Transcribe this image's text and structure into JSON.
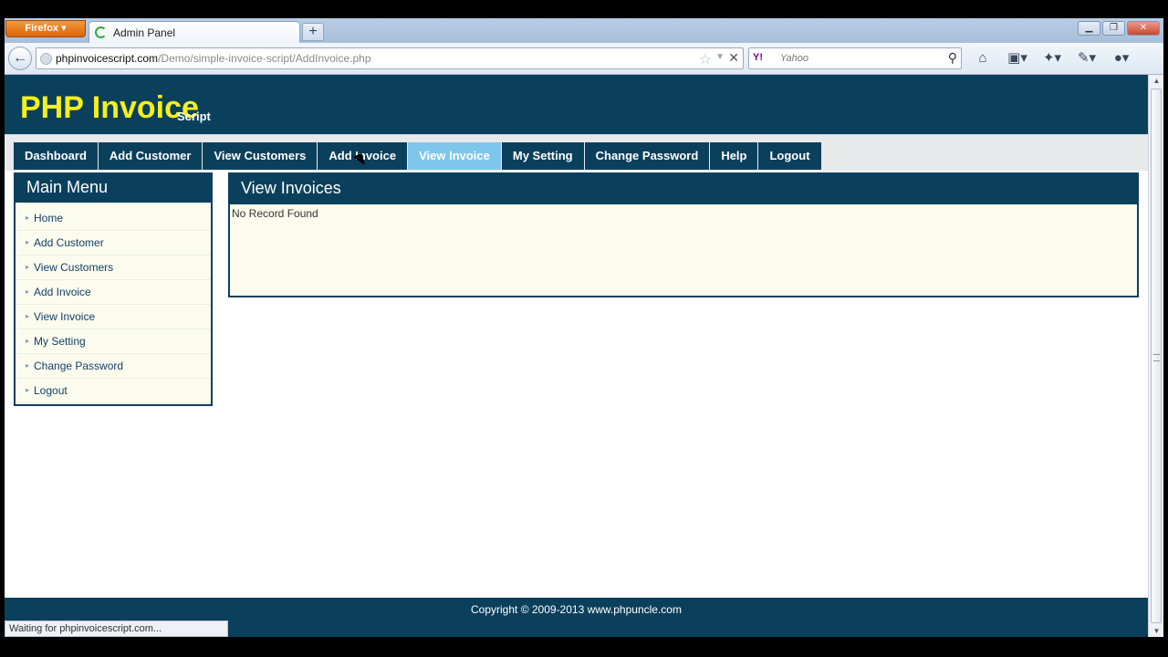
{
  "browser": {
    "firefox_label": "Firefox",
    "tab_title": "Admin Panel",
    "newtab_label": "+",
    "back_label": "←",
    "url_host": "phpinvoicescript.com",
    "url_path": "/Demo/simple-invoice-script/AddInvoice.php",
    "search_logo": "Y!",
    "search_placeholder": "Yahoo",
    "status_text": "Waiting for phpinvoicescript.com..."
  },
  "header": {
    "logo_main": "PHP Invoice",
    "logo_sub": "Script"
  },
  "menu": {
    "items": [
      {
        "label": "Dashboard"
      },
      {
        "label": "Add Customer"
      },
      {
        "label": "View Customers"
      },
      {
        "label": "Add Invoice"
      },
      {
        "label": "View Invoice"
      },
      {
        "label": "My Setting"
      },
      {
        "label": "Change Password"
      },
      {
        "label": "Help"
      },
      {
        "label": "Logout"
      }
    ]
  },
  "sidebar": {
    "title": "Main Menu",
    "items": [
      {
        "label": "Home"
      },
      {
        "label": "Add Customer"
      },
      {
        "label": "View Customers"
      },
      {
        "label": "Add Invoice"
      },
      {
        "label": "View Invoice"
      },
      {
        "label": "My Setting"
      },
      {
        "label": "Change Password"
      },
      {
        "label": "Logout"
      }
    ]
  },
  "main": {
    "title": "View Invoices",
    "message": "No Record Found"
  },
  "footer": {
    "copyright": "Copyright © 2009-2013 www.phpuncle.com"
  },
  "colors": {
    "brand_dark": "#0b405c",
    "logo_yellow": "#f5ef1d",
    "active_menu": "#7fc6ec",
    "panel_bg": "#fbfcee"
  }
}
